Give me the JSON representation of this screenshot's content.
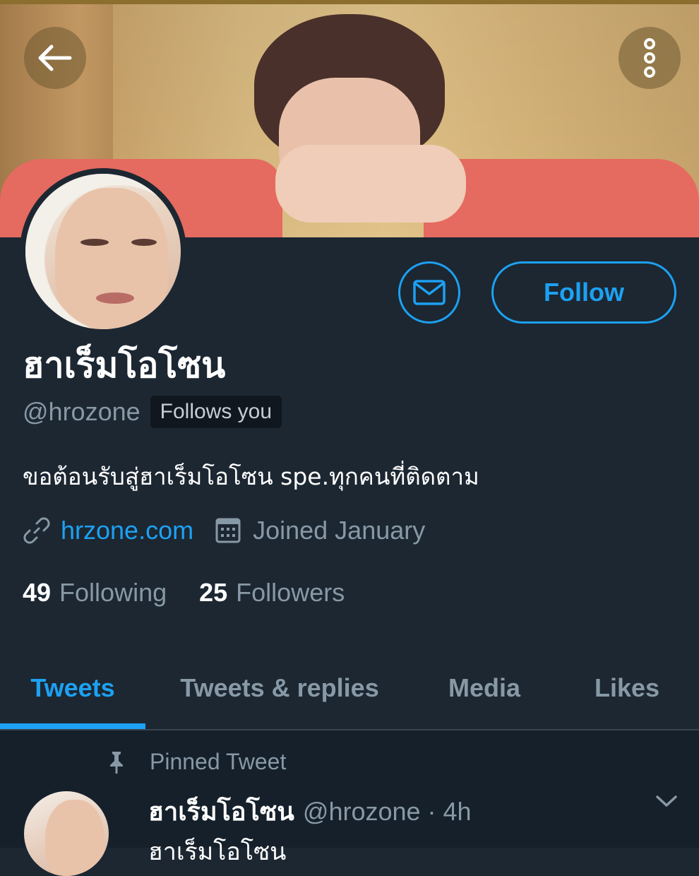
{
  "header": {
    "back_icon": "arrow-left-icon",
    "more_icon": "more-vertical-icon"
  },
  "actions": {
    "message_icon": "envelope-icon",
    "follow_label": "Follow"
  },
  "profile": {
    "display_name": "ฮาเร็มโอโซน",
    "handle": "@hrozone",
    "follows_you_label": "Follows you",
    "bio": "ขอต้อนรับสู่ฮาเร็มโอโซน spe.ทุกคนที่ติดตาม",
    "website": "hrzone.com",
    "joined": "Joined January",
    "following_count": "49",
    "following_label": "Following",
    "followers_count": "25",
    "followers_label": "Followers"
  },
  "tabs": [
    {
      "label": "Tweets",
      "active": true
    },
    {
      "label": "Tweets & replies",
      "active": false
    },
    {
      "label": "Media",
      "active": false
    },
    {
      "label": "Likes",
      "active": false
    }
  ],
  "tweet": {
    "pinned_label": "Pinned Tweet",
    "author_name": "ฮาเร็มโอโซน",
    "author_meta": "@hrozone · 4h",
    "text_partial": "ฮาเร็มโอโซน"
  },
  "colors": {
    "accent": "#1da1f2",
    "background": "#1c2732",
    "muted": "#8899a6"
  }
}
